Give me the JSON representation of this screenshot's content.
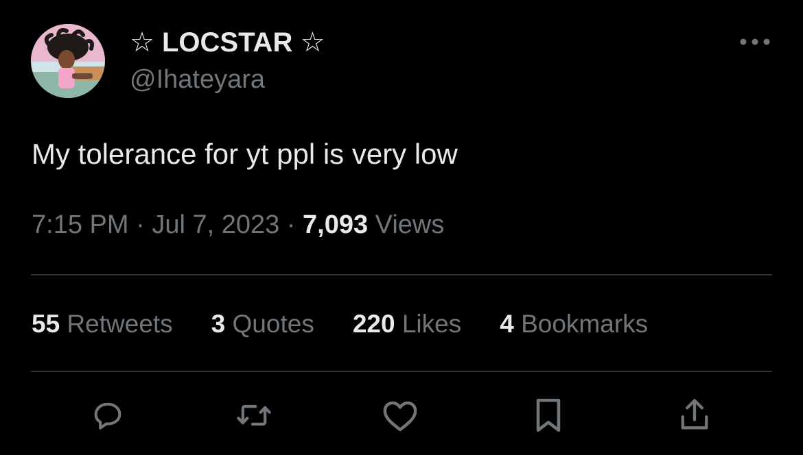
{
  "author": {
    "display_name": "☆ LOCSTAR ☆",
    "handle": "@Ihateyara",
    "avatar_icon": "profile-picture-avatar"
  },
  "more_icon": "more-options-icon",
  "tweet": {
    "text": "My tolerance for yt ppl is very low",
    "time": "7:15 PM",
    "separator": "·",
    "date": "Jul 7, 2023",
    "views_count": "7,093",
    "views_label": "Views"
  },
  "stats": {
    "retweets_count": "55",
    "retweets_label": "Retweets",
    "quotes_count": "3",
    "quotes_label": "Quotes",
    "likes_count": "220",
    "likes_label": "Likes",
    "bookmarks_count": "4",
    "bookmarks_label": "Bookmarks"
  },
  "actions": [
    {
      "icon": "reply-icon"
    },
    {
      "icon": "retweet-icon"
    },
    {
      "icon": "like-heart-icon"
    },
    {
      "icon": "bookmark-icon"
    },
    {
      "icon": "share-icon"
    }
  ],
  "colors": {
    "background": "#000000",
    "primary_text": "#e7e9ea",
    "secondary_text": "#71767b",
    "divider": "#2f3336"
  }
}
